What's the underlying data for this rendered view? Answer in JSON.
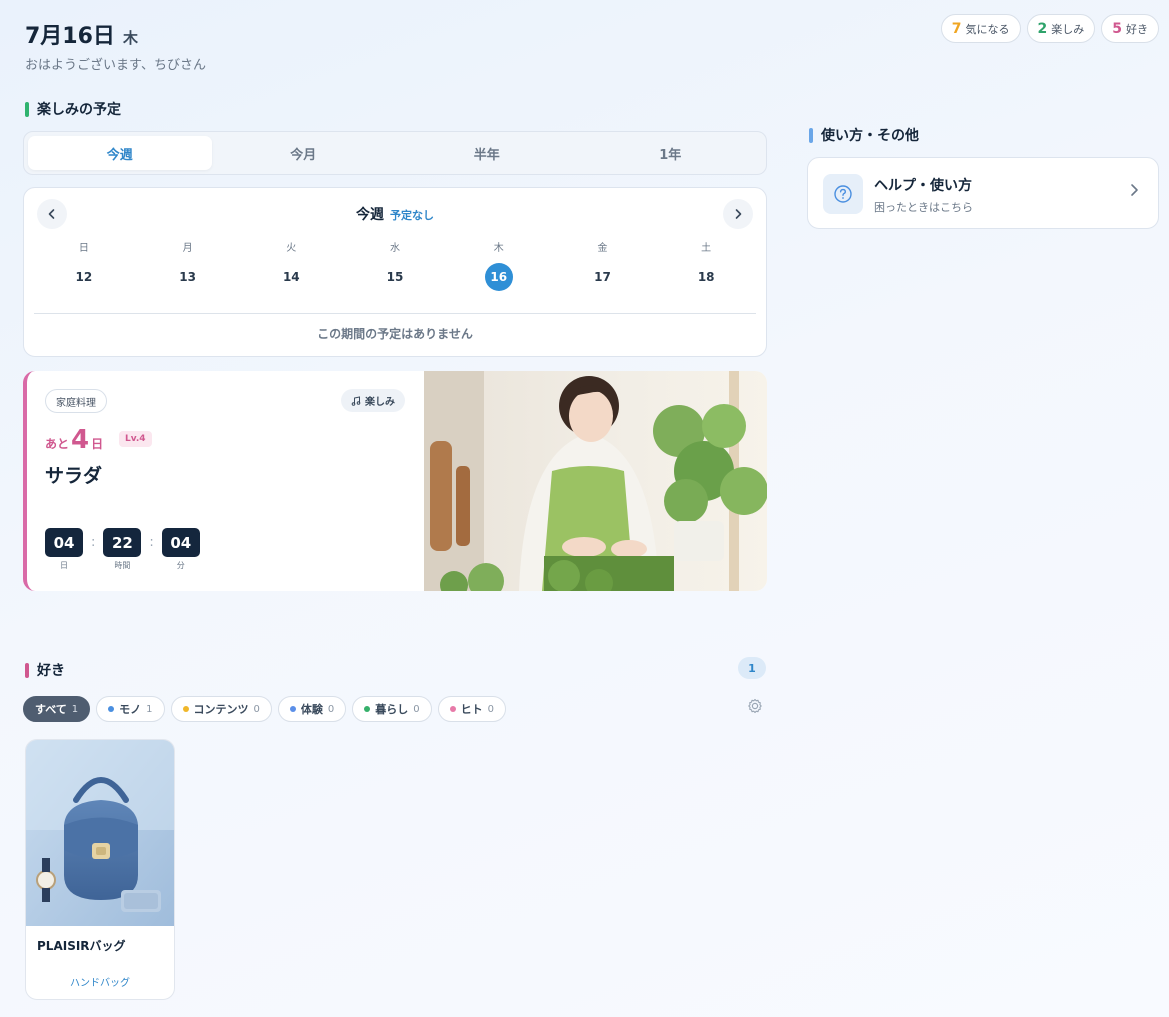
{
  "header": {
    "date": "7月16日",
    "weekday": "木",
    "greeting": "おはようございます、ちびさん"
  },
  "stats": [
    {
      "count": "7",
      "label": "気になる",
      "color": "#f0a623"
    },
    {
      "count": "2",
      "label": "楽しみ",
      "color": "#2fa36b"
    },
    {
      "count": "5",
      "label": "好き",
      "color": "#d0588f"
    }
  ],
  "plans": {
    "title": "楽しみの予定",
    "bar_color": "#2fb36f",
    "tabs": [
      "今週",
      "今月",
      "半年",
      "1年"
    ],
    "active_tab": "今週",
    "calendar": {
      "title": "今週",
      "subtitle": "予定なし",
      "weekdays": [
        "日",
        "月",
        "火",
        "水",
        "木",
        "金",
        "土"
      ],
      "days": [
        "12",
        "13",
        "14",
        "15",
        "16",
        "17",
        "18"
      ],
      "today": "16",
      "empty_message": "この期間の予定はありません"
    },
    "event": {
      "tag": "家庭料理",
      "kind": "楽しみ",
      "prefix": "あと",
      "days_left": "4",
      "days_unit": "日",
      "level": "Lv.4",
      "title": "サラダ",
      "timer": [
        {
          "value": "04",
          "label": "日"
        },
        {
          "value": "22",
          "label": "時間"
        },
        {
          "value": "04",
          "label": "分"
        }
      ]
    }
  },
  "likes": {
    "title": "好き",
    "bar_color": "#d0588f",
    "count": "1",
    "filters": [
      {
        "label": "すべて",
        "count": "1",
        "dot": null
      },
      {
        "label": "モノ",
        "count": "1",
        "dot": "#4a8fe0"
      },
      {
        "label": "コンテンツ",
        "count": "0",
        "dot": "#f0b72a"
      },
      {
        "label": "体験",
        "count": "0",
        "dot": "#5b8fe8"
      },
      {
        "label": "暮らし",
        "count": "0",
        "dot": "#36b06a"
      },
      {
        "label": "ヒト",
        "count": "0",
        "dot": "#e77aa8"
      }
    ],
    "items": [
      {
        "name": "PLAISIRバッグ",
        "category": "ハンドバッグ"
      }
    ]
  },
  "sidebar": {
    "title": "使い方・その他",
    "bar_color": "#6aa6e8",
    "help": {
      "title": "ヘルプ・使い方",
      "subtitle": "困ったときはこちら"
    }
  }
}
